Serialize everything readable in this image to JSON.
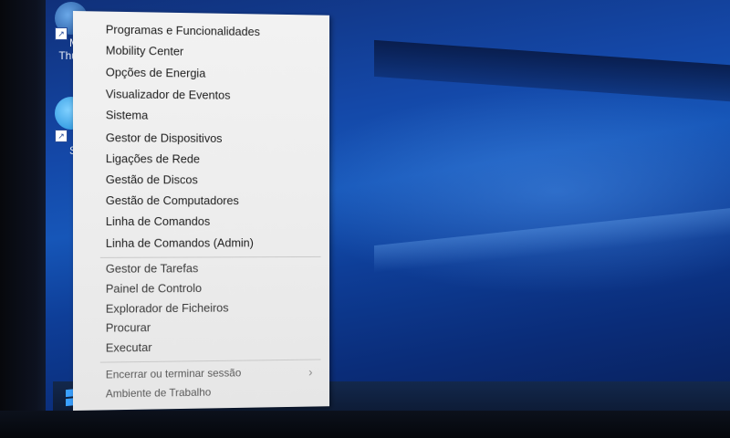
{
  "desktop": {
    "icons": [
      {
        "label_line1": "M",
        "label_line2": "Thun"
      },
      {
        "label_line1": "Sk",
        "label_line2": ""
      }
    ]
  },
  "menu": {
    "items": [
      "Programas e Funcionalidades",
      "Mobility Center",
      "Opções de Energia",
      "Visualizador de Eventos",
      "Sistema",
      "Gestor de Dispositivos",
      "Ligações de Rede",
      "Gestão de Discos",
      "Gestão de Computadores",
      "Linha de Comandos",
      "Linha de Comandos (Admin)",
      "Gestor de Tarefas",
      "Painel de Controlo",
      "Explorador de Ficheiros",
      "Procurar",
      "Executar",
      "Encerrar ou terminar sessão",
      "Ambiente de Trabalho"
    ],
    "submenu_arrow": "›"
  },
  "colors": {
    "accent": "#3aa0ff",
    "menu_bg": "#f0f0f0",
    "desktop_blue": "#1448a8"
  }
}
